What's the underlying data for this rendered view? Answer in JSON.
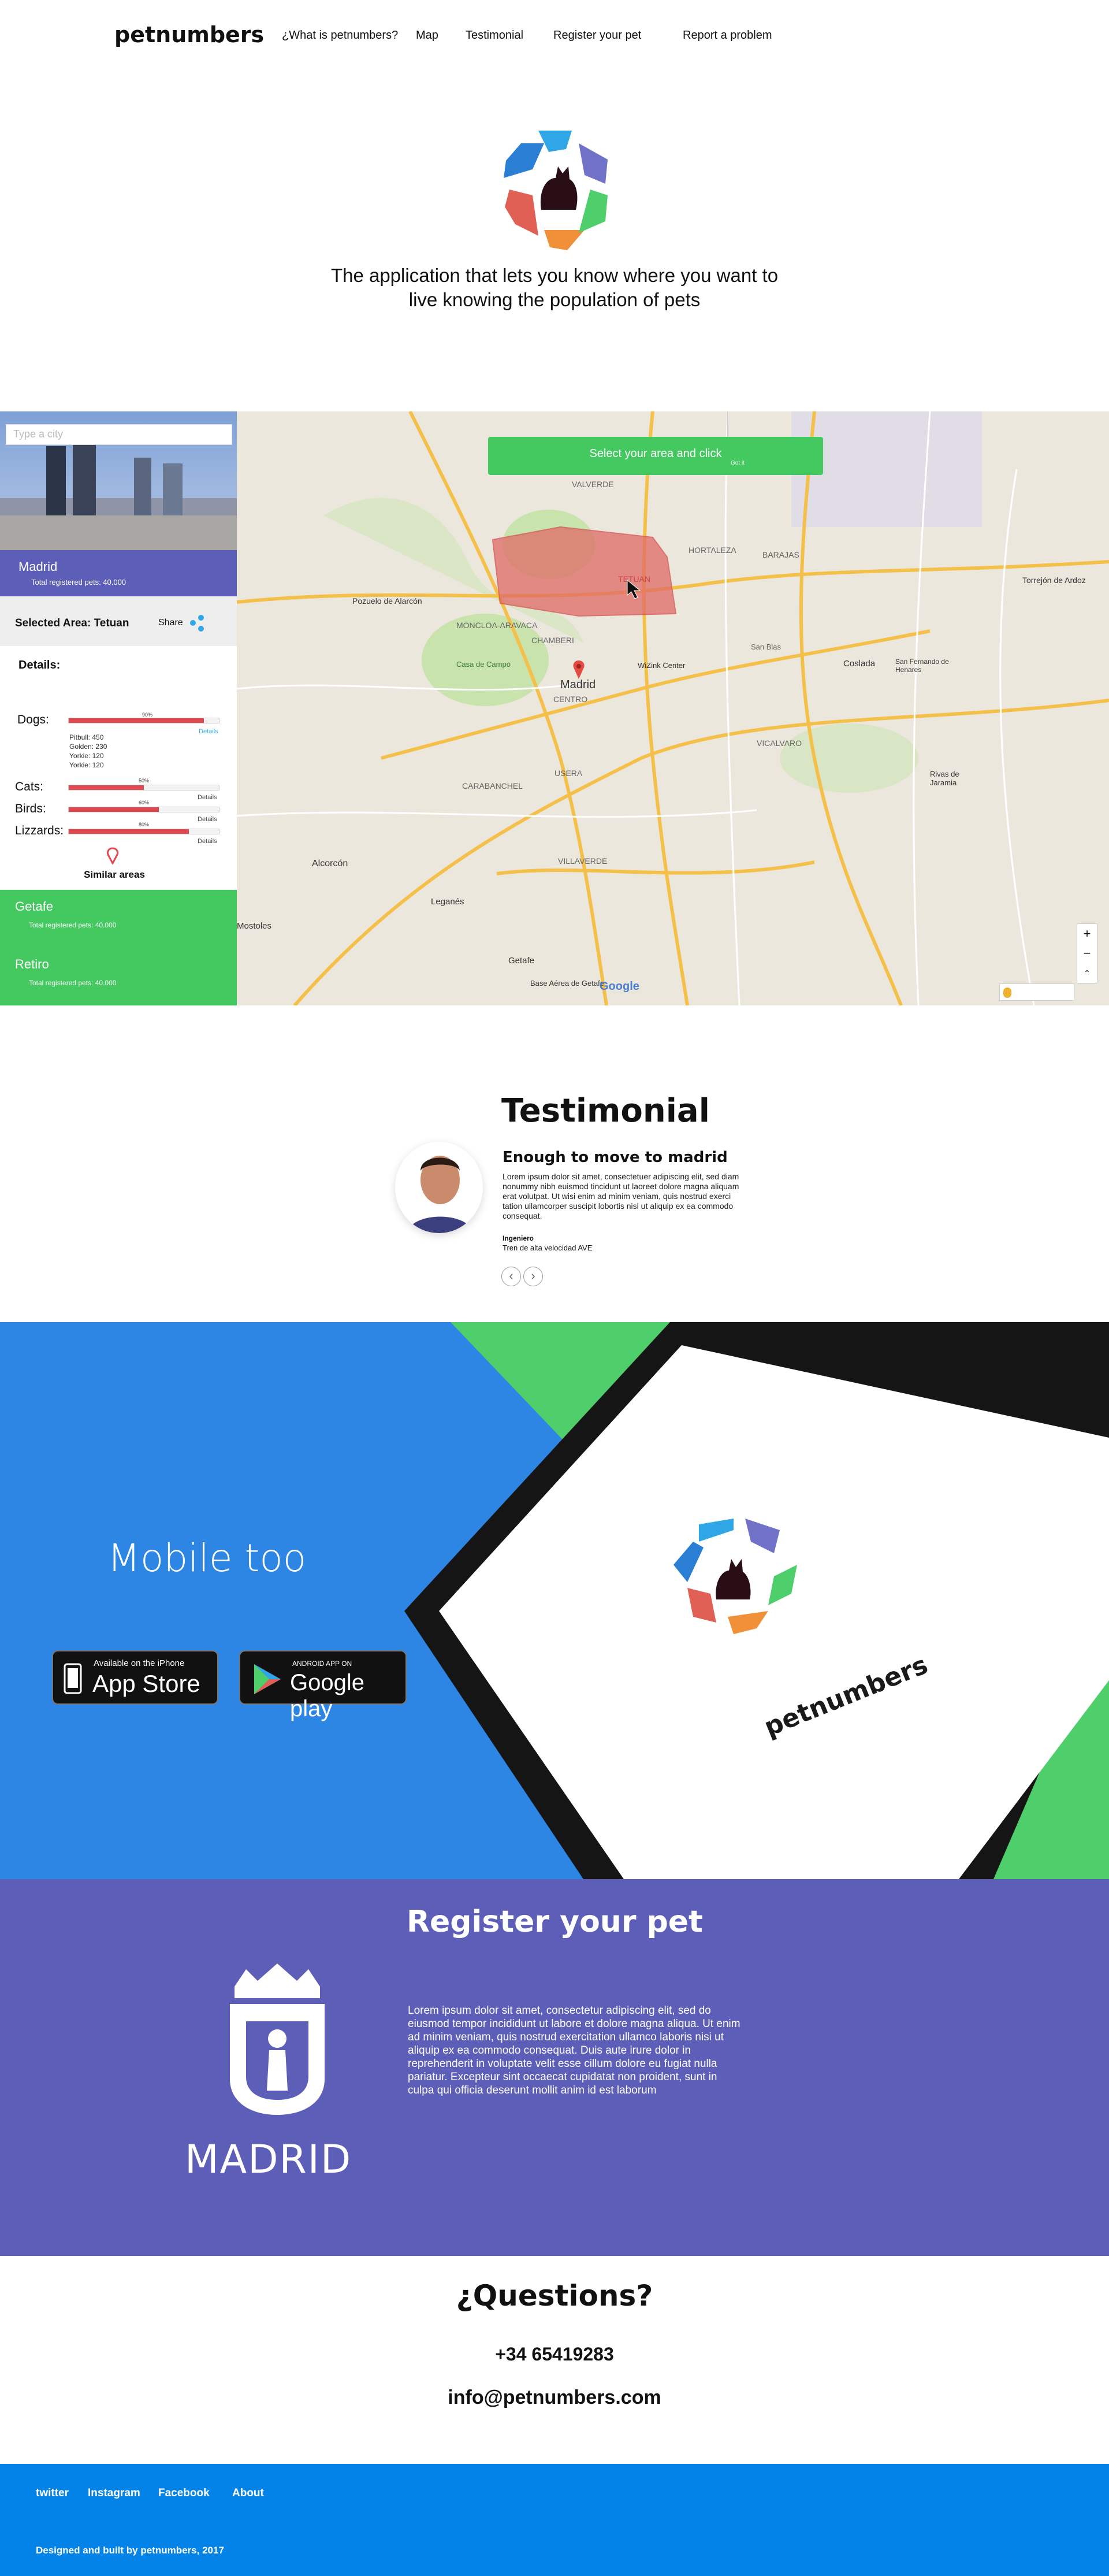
{
  "header": {
    "brand": "petnumbers",
    "nav": [
      "¿What is petnumbers?",
      "Map",
      "Testimonial",
      "Register your pet",
      "Report a problem"
    ]
  },
  "hero": {
    "tagline_line1": "The application that lets you know where you want to",
    "tagline_line2": "live knowing the population of pets"
  },
  "sidebar": {
    "search_placeholder": "Type a city",
    "city": "Madrid",
    "total": "Total registered pets: 40.000",
    "selected_area": "Selected Area: Tetuan",
    "share": "Share",
    "details_title": "Details:",
    "dogs_label": "Dogs:",
    "dogs_pct": "90%",
    "dogs_progress": 0.9,
    "dogs_details": "Details",
    "dog_breeds": [
      "Pitbull: 450",
      "Golden: 230",
      "Yorkie: 120",
      "Yorkie: 120"
    ],
    "cats_label": "Cats:",
    "cats_pct": "50%",
    "cats_progress": 0.5,
    "birds_label": "Birds:",
    "birds_pct": "60%",
    "birds_progress": 0.6,
    "lizz_label": "Lizzards:",
    "lizz_pct": "80%",
    "lizz_progress": 0.8,
    "details_link": "Details",
    "similar": "Similar areas",
    "areas": [
      {
        "name": "Getafe",
        "total": "Total registered pets: 40.000"
      },
      {
        "name": "Retiro",
        "total": "Total registered pets: 40.000"
      }
    ]
  },
  "map": {
    "button": "Select your area and click",
    "button_sub": "Got it",
    "labels": [
      "VALVERDE",
      "HORTALEZA",
      "BARAJAS",
      "TETUAN",
      "CHAMBERI",
      "Madrid",
      "CENTRO",
      "MONCLOA-ARAVACA",
      "Casa de Campo",
      "CARABANCHEL",
      "USERA",
      "VILLAVERDE",
      "Leganés",
      "Getafe",
      "Alcorcón",
      "Pozuelo de Alarcón",
      "VICALVARO",
      "Coslada",
      "San Fernando de Henares",
      "Torrejón de Ardoz",
      "Rivas de Jaramia",
      "Mostoles",
      "Base Aérea de Getafe",
      "WiZink Center",
      "San Blas"
    ],
    "google": "Google",
    "zoom_in": "+",
    "zoom_out": "−"
  },
  "testimonial": {
    "title": "Testimonial",
    "subtitle": "Enough to move to madrid",
    "body": "Lorem ipsum dolor sit amet, consectetuer adipiscing elit, sed diam nonummy nibh euismod tincidunt ut laoreet dolore magna aliquam erat volutpat. Ut wisi enim ad minim veniam, quis nostrud exerci tation ullamcorper suscipit lobortis nisl ut aliquip ex ea commodo consequat.",
    "author": "Ingeniero",
    "role": "Tren de alta velocidad AVE",
    "prev": "‹",
    "next": "›"
  },
  "mobile": {
    "title": "Mobile too",
    "appstore_small": "Available on the iPhone",
    "appstore_big": "App Store",
    "gplay_small": "ANDROID APP ON",
    "gplay_big": "Google play",
    "phone_brand": "petnumbers"
  },
  "register": {
    "title": "Register your pet",
    "body": "Lorem ipsum dolor sit amet, consectetur adipiscing elit, sed do eiusmod tempor incididunt ut labore et dolore magna aliqua. Ut enim ad minim veniam, quis nostrud exercitation ullamco laboris nisi ut aliquip ex ea commodo consequat. Duis aute irure dolor in reprehenderit in voluptate velit esse cillum dolore eu fugiat nulla pariatur. Excepteur sint occaecat cupidatat non proident, sunt in culpa qui officia deserunt mollit anim id est laborum",
    "city": "MADRID"
  },
  "questions": {
    "title": "¿Questions?",
    "phone": "+34 65419283",
    "email": "info@petnumbers.com"
  },
  "footer": {
    "links": [
      "twitter",
      "Instagram",
      "Facebook",
      "About"
    ],
    "credit": "Designed and built  by petnumbers, 2017"
  },
  "colors": {
    "purple": "#5d5eb8",
    "green": "#43c95f",
    "blue": "#2d86e3",
    "footer_blue": "#0383e8",
    "bar_red": "#e0474e"
  }
}
